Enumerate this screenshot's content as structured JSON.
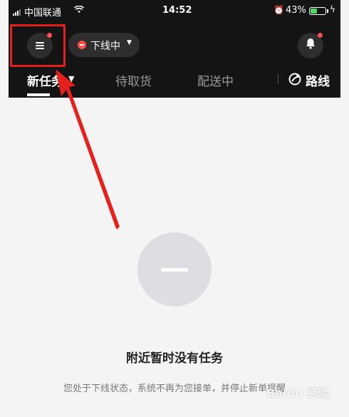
{
  "status_bar": {
    "carrier": "中国联通",
    "time": "14:52",
    "battery_percent": "43%",
    "battery_level": 0.43,
    "wifi_icon": "wifi-icon",
    "alarm_icon": "alarm-icon"
  },
  "top_bar": {
    "menu_icon": "menu-icon",
    "status_label": "下线中",
    "status_color": "#ff4d4d",
    "bell_icon": "bell-icon"
  },
  "tabs": [
    {
      "label": "新任务",
      "active": true
    },
    {
      "label": "待取货",
      "active": false
    },
    {
      "label": "配送中",
      "active": false
    }
  ],
  "route_button": {
    "label": "路线"
  },
  "empty_state": {
    "title": "附近暂时没有任务",
    "description": "您处于下线状态，系统不再为您接单，并停止新单提醒"
  },
  "annotation": {
    "highlight_color": "#e8201c"
  },
  "watermark": "Baidu 经验"
}
